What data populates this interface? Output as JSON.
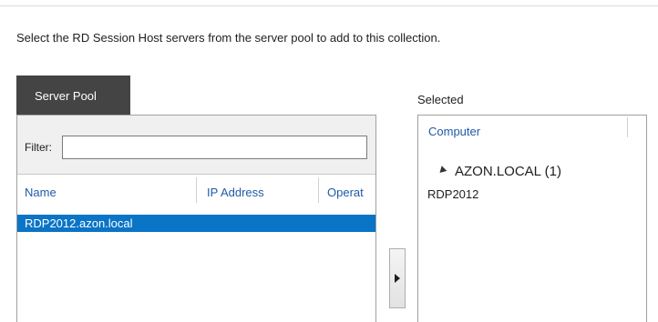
{
  "instructions": "Select the RD Session Host servers from the server pool to add to this collection.",
  "server_pool": {
    "tab_label": "Server Pool",
    "filter_label": "Filter:",
    "filter_value": "",
    "columns": [
      "Name",
      "IP Address",
      "Operat"
    ],
    "rows": [
      {
        "name": "RDP2012.azon.local",
        "ip_address": "",
        "operating_system": "",
        "selected": true
      }
    ]
  },
  "add_button": {
    "icon": "play-arrow-icon"
  },
  "selected": {
    "title": "Selected",
    "column": "Computer",
    "group_label": "AZON.LOCAL (1)",
    "items": [
      "RDP2012"
    ]
  },
  "colors": {
    "tab_bg": "#444444",
    "selection": "#0a74c6",
    "header_text": "#1f5aa8"
  }
}
